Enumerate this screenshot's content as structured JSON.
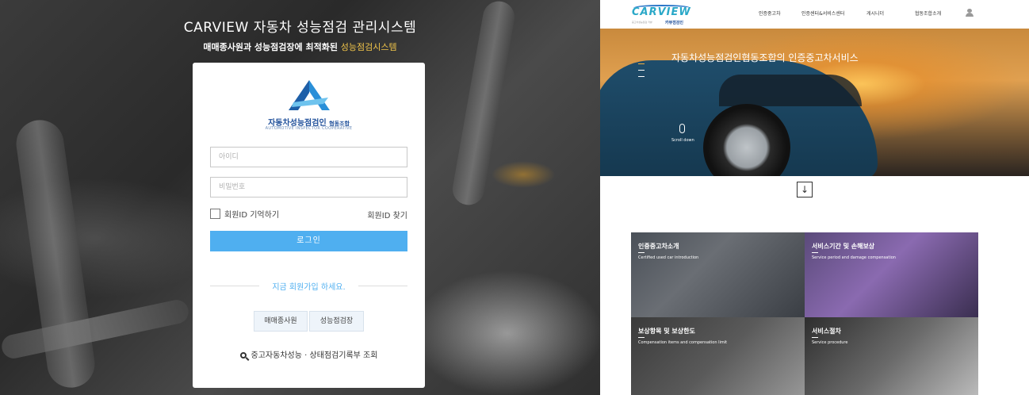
{
  "login": {
    "system_title": "CARVIEW 자동차 성능점검 관리시스템",
    "subtitle_main": "매매종사원과 성능점검장에 최적화된 ",
    "subtitle_highlight": "성능점검시스템",
    "logo_title": "자동차성능점검인 ",
    "logo_title_small": "협동조합",
    "logo_en": "AUTOMOTIVE INSPECTOR COOPERATIVE",
    "id_placeholder": "아이디",
    "pw_placeholder": "비밀번호",
    "remember_label": "회원ID 기억하기",
    "find_id_label": "회원ID 찾기",
    "login_button": "로그인",
    "join_prompt": "지금 회원가입 하세요.",
    "join_dealer": "매매종사원",
    "join_inspection": "성능점검장",
    "lookup_label": "중고자동차성능 · 상태점검기록부 조회",
    "accent_color": "#4faff0"
  },
  "site": {
    "brand": "CARVIEW",
    "brand_kor": "카뷰점검인",
    "brand_tagline": "중고차성능점검 카뷰",
    "nav": [
      "인증중고차",
      "인증센터&서비스센터",
      "게시니더",
      "협동조합소개"
    ],
    "hero_title": "자동차성능점검인협동조합의 인증중고차서비스",
    "scroll_label": "Scroll down",
    "down_arrow": "↓",
    "tiles": [
      {
        "title": "인증중고차소개",
        "subtitle": "Certified used car introduction"
      },
      {
        "title": "서비스기간 및 손해보상",
        "subtitle": "Service period and damage compensation"
      },
      {
        "title": "보상항목 및 보상한도",
        "subtitle": "Compensation items and compensation limit"
      },
      {
        "title": "서비스절차",
        "subtitle": "Service procedure"
      }
    ]
  }
}
